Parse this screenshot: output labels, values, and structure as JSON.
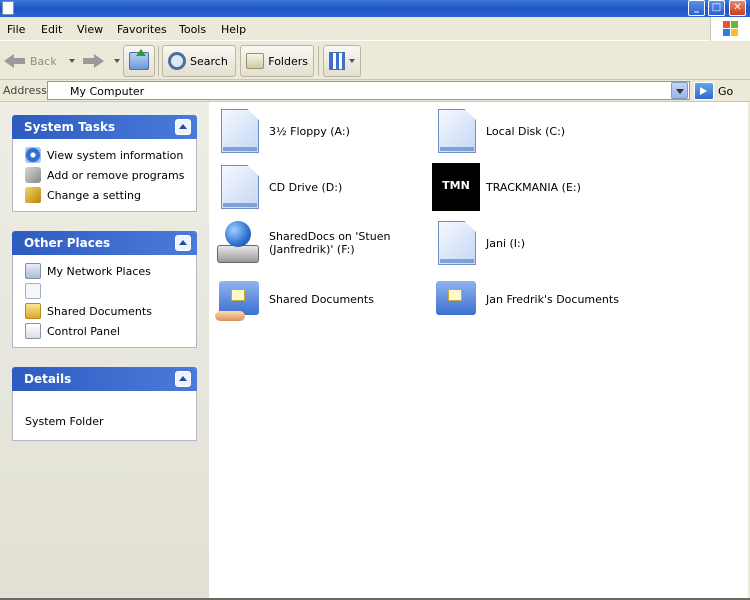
{
  "menu": [
    "File",
    "Edit",
    "View",
    "Favorites",
    "Tools",
    "Help"
  ],
  "toolbar": {
    "back_label": "Back",
    "search_label": "Search",
    "folders_label": "Folders"
  },
  "address": {
    "label": "Address",
    "value": "My Computer",
    "go_label": "Go"
  },
  "panels": {
    "system_tasks": {
      "title": "System Tasks",
      "links": [
        "View system information",
        "Add or remove programs",
        "Change a setting"
      ]
    },
    "other_places": {
      "title": "Other Places",
      "links": [
        "My Network Places",
        "",
        "Shared Documents",
        "Control Panel"
      ]
    },
    "details": {
      "title": "Details",
      "text": "System Folder"
    }
  },
  "items": [
    {
      "label": "3½ Floppy (A:)",
      "icon": "floppy-drive-icon"
    },
    {
      "label": "Local Disk (C:)",
      "icon": "local-disk-icon"
    },
    {
      "label": "CD Drive (D:)",
      "icon": "cd-drive-icon"
    },
    {
      "label": "TRACKMANIA (E:)",
      "icon": "trackmania-drive-icon"
    },
    {
      "label": "SharedDocs on 'Stuen (Janfredrik)' (F:)",
      "icon": "network-drive-icon"
    },
    {
      "label": "Jani (I:)",
      "icon": "removable-drive-icon"
    },
    {
      "label": "Shared Documents",
      "icon": "shared-folder-icon"
    },
    {
      "label": "Jan Fredrik's Documents",
      "icon": "documents-folder-icon"
    }
  ],
  "trackmania_logo_text": "TMN"
}
